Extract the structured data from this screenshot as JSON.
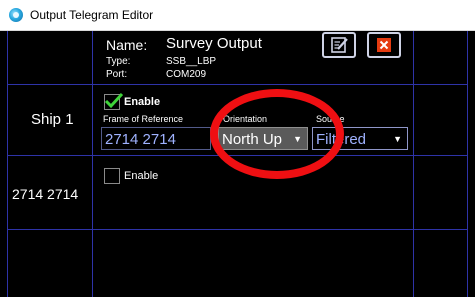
{
  "window": {
    "title": "Output Telegram Editor"
  },
  "header": {
    "name_label": "Name:",
    "name_value": "Survey Output",
    "type_label": "Type:",
    "type_value": "SSB__LBP",
    "port_label": "Port:",
    "port_value": "COM209"
  },
  "rows": [
    {
      "label": "Ship 1",
      "enable_checked": true,
      "enable_label": "Enable",
      "frame_label": "Frame of Reference",
      "frame_value": "2714 2714",
      "orientation_label": "Orientation",
      "orientation_value": "North Up",
      "source_label": "Source",
      "source_value": "Filtered"
    },
    {
      "label": "2714 2714",
      "enable_checked": false,
      "enable_label": "Enable"
    }
  ],
  "colors": {
    "background": "#000000",
    "grid_line": "#2e33a8",
    "checkmark": "#3fd43a",
    "delete_button": "#e63b10",
    "highlight_circle": "#ef0f12"
  },
  "icons": [
    "app-icon",
    "edit-icon",
    "delete-icon",
    "checkmark-icon",
    "chevron-down-icon"
  ]
}
